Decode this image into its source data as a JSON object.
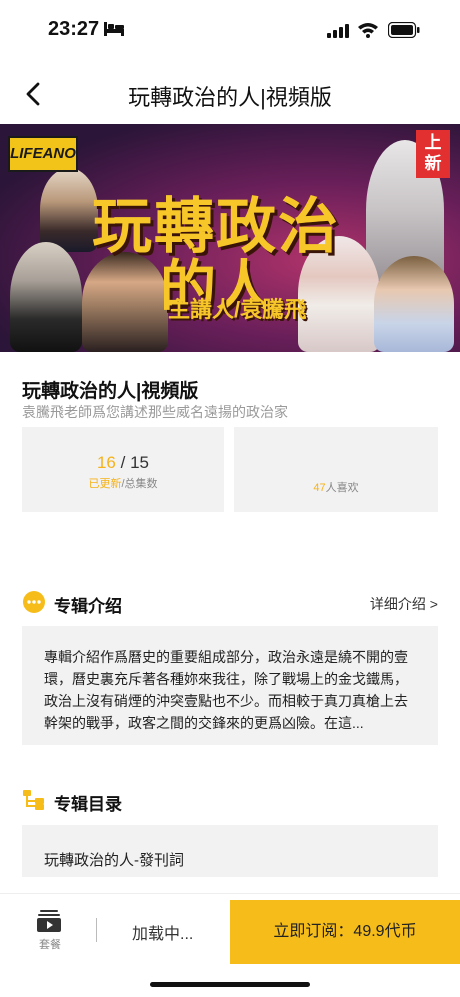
{
  "status_bar": {
    "time": "23:27"
  },
  "nav": {
    "title": "玩轉政治的人|視頻版"
  },
  "banner": {
    "logo": "LIFEANO",
    "new_tag_line1": "上",
    "new_tag_line2": "新",
    "title_line1": "玩轉政治",
    "title_line2": "的人",
    "host": "主講人/袁騰飛"
  },
  "album": {
    "title": "玩轉政治的人|視頻版",
    "subtitle": "袁騰飛老師爲您講述那些威名遠揚的政治家",
    "updated": "16",
    "separator": "/",
    "total": "15",
    "updated_label": "已更新",
    "total_label": "/总集数",
    "likes_count": "47",
    "likes_label": "人喜欢"
  },
  "intro_section": {
    "heading": "专辑介绍",
    "more_link": "详细介绍 >",
    "text": "專輯介紹作爲曆史的重要組成部分，政治永遠是繞不開的壹環，曆史裏充斥著各種妳來我往，除了戰場上的金戈鐵馬，政治上沒有硝煙的沖突壹點也不少。而相較于真刀真槍上去幹架的戰爭，政客之間的交鋒來的更爲凶險。在這..."
  },
  "catalog_section": {
    "heading": "专辑目录",
    "items": [
      {
        "title": "玩轉政治的人-發刊詞"
      }
    ]
  },
  "bottom_bar": {
    "package_label": "套餐",
    "loading_text": "加载中...",
    "buy_label": "立即订阅：49.9代币"
  },
  "colors": {
    "accent": "#f6bd1a",
    "banner_title": "#f7c72a",
    "new_tag": "#e23030"
  },
  "icons": [
    "back-icon",
    "bed-icon",
    "signal-icon",
    "wifi-icon",
    "battery-icon",
    "more-dots-icon",
    "catalog-icon",
    "package-icon"
  ]
}
